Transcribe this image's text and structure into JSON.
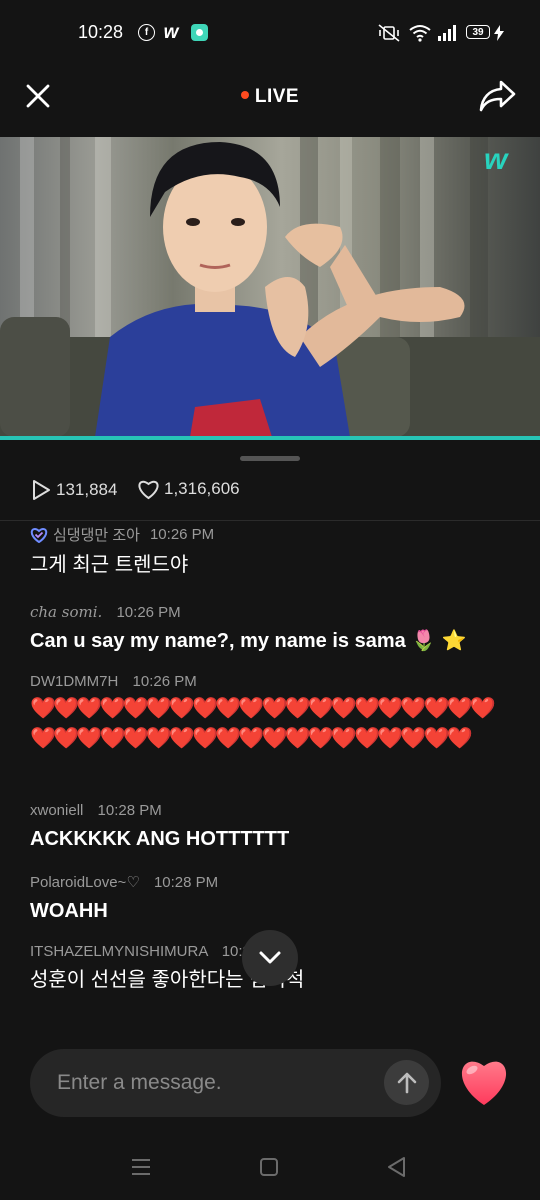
{
  "status_bar": {
    "time": "10:28",
    "app_icons": [
      "facebook-icon",
      "weverse-icon",
      "app-badge-icon"
    ],
    "weverse_glyph": "w",
    "battery": "39"
  },
  "header": {
    "live_label": "LIVE",
    "live_dot_color": "#ff4b1f"
  },
  "video": {
    "progress_color": "#27c4b6",
    "watermark": "w"
  },
  "stats": {
    "views": "131,884",
    "likes": "1,316,606"
  },
  "chat": {
    "messages": [
      {
        "user": "심댕댕만 조아",
        "time": "10:26 PM",
        "text": "그게 최근 트렌드야"
      },
      {
        "user": "cha somi.",
        "time": "10:26 PM",
        "text": "Can u say my name?, my name is sama 🌷 ⭐"
      },
      {
        "user": "DW1DMM7H",
        "time": "10:26 PM",
        "text": "❤️❤️❤️❤️❤️❤️❤️❤️❤️❤️❤️❤️❤️❤️❤️❤️❤️❤️❤️❤️❤️❤️❤️❤️❤️❤️❤️❤️❤️❤️❤️❤️❤️❤️❤️❤️❤️❤️❤️"
      },
      {
        "user": "xwoniell",
        "time": "10:28 PM",
        "text": "ACKKKKK ANG HOTTTTTT"
      },
      {
        "user": "PolaroidLove~♡",
        "time": "10:28 PM",
        "text": "WOAHH"
      },
      {
        "user": "ITSHAZELMYNISHIMURA",
        "time": "10:28 PM",
        "text": "성훈이 선선을 좋아한다는 팀지척"
      }
    ]
  },
  "composer": {
    "placeholder": "Enter a message."
  },
  "colors": {
    "background": "#141414",
    "accent": "#27c4b6",
    "heart": "#ff4d6d"
  }
}
